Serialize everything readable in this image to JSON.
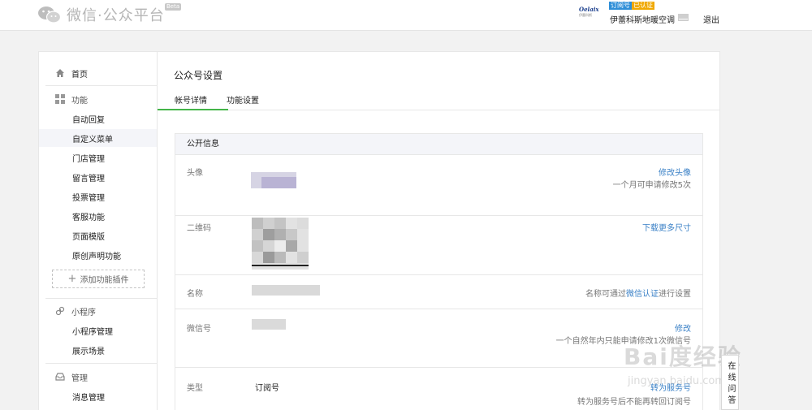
{
  "header": {
    "brand": "微信·公众平台",
    "beta": "Beta",
    "account_logo": "Oelaix",
    "account_logo_sub": "伊蕾科斯",
    "tag_subscription": "订阅号",
    "tag_unverified": "已认证",
    "account_name": "伊蕾科斯地暖空调",
    "logout": "退出"
  },
  "sidebar": {
    "home": "首页",
    "functions": "功能",
    "function_items": [
      "自动回复",
      "自定义菜单",
      "门店管理",
      "留言管理",
      "投票管理",
      "客服功能",
      "页面模版",
      "原创声明功能"
    ],
    "add_plugin": "添加功能插件",
    "miniprogram": "小程序",
    "miniprogram_items": [
      "小程序管理",
      "展示场景"
    ],
    "manage": "管理",
    "manage_items": [
      "消息管理"
    ]
  },
  "main": {
    "title": "公众号设置",
    "tabs": [
      "帐号详情",
      "功能设置"
    ],
    "section_title": "公开信息",
    "rows": {
      "avatar": {
        "label": "头像",
        "link": "修改头像",
        "note": "一个月可申请修改5次"
      },
      "qrcode": {
        "label": "二维码",
        "link": "下载更多尺寸"
      },
      "name": {
        "label": "名称",
        "note_pre": "名称可通过",
        "note_link": "微信认证",
        "note_post": "进行设置"
      },
      "wechat_id": {
        "label": "微信号",
        "link": "修改",
        "note": "一个自然年内只能申请修改1次微信号"
      },
      "type": {
        "label": "类型",
        "value": "订阅号",
        "link": "转为服务号",
        "note": "转为服务号后不能再转回订阅号"
      }
    }
  },
  "watermark": {
    "text": "Bai度经验",
    "sub": "jingyan.baidu.com"
  },
  "help": {
    "label": "在线问答"
  }
}
